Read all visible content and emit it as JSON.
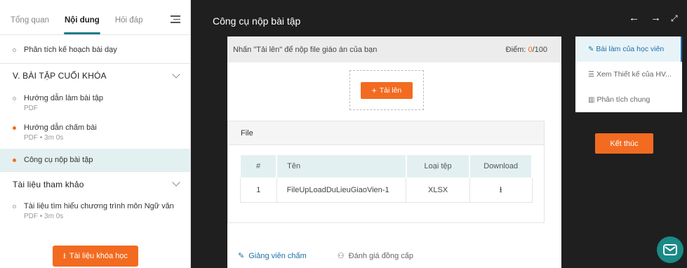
{
  "sidebar": {
    "tabs": [
      "Tổng quan",
      "Nội dung",
      "Hỏi đáp"
    ],
    "lessons_top": [
      {
        "title": "Phân tích kế hoạch bài dạy",
        "sub": ""
      }
    ],
    "section_5": {
      "title": "V. BÀI TẬP CUỐI KHÓA",
      "lessons": [
        {
          "title": "Hướng dẫn làm bài tập",
          "sub": "PDF"
        },
        {
          "title": "Hướng dẫn chấm bài",
          "sub": "PDF • 3m 0s"
        },
        {
          "title": "Công cụ nộp bài tập",
          "sub": ""
        }
      ]
    },
    "section_ref": {
      "title": "Tài liệu tham khảo",
      "lessons": [
        {
          "title": "Tài liệu tìm hiểu chương trình môn Ngữ văn",
          "sub": "PDF • 3m 0s"
        }
      ]
    },
    "docs_button": "Tài liệu khóa học"
  },
  "main": {
    "title": "Công cụ nộp bài tập",
    "instruction": "Nhấn \"Tải lên\" để nộp file giáo án của bạn",
    "score_label": "Điểm: ",
    "score_value": "0",
    "score_max": "/100",
    "upload_label": "Tải lên",
    "file_header": "File",
    "table": {
      "headers": [
        "#",
        "Tên",
        "Loại tệp",
        "Download"
      ],
      "rows": [
        {
          "num": "1",
          "name": "FileUpLoadDuLieuGiaoVien-1",
          "type": "XLSX"
        }
      ]
    },
    "footer_links": [
      "Giảng viên chấm",
      "Đánh giá đồng cấp"
    ]
  },
  "right_menu": {
    "items": [
      "Bài làm của học viên",
      "Xem Thiết kế của HV...",
      "Phân tích chung"
    ],
    "end_button": "Kết thúc"
  },
  "colors": {
    "accent": "#f26b21",
    "teal": "#1d7a8c",
    "link": "#1d6fa8"
  }
}
